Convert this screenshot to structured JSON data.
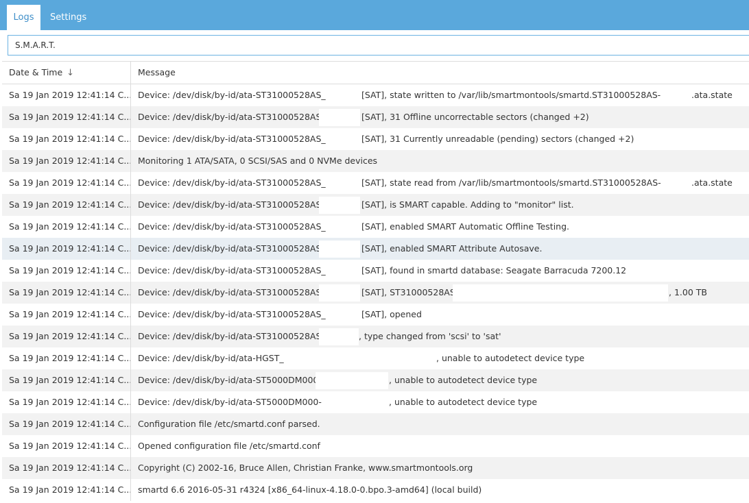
{
  "tabs": {
    "logs": "Logs",
    "settings": "Settings"
  },
  "search": {
    "value": "S.M.A.R.T."
  },
  "columns": {
    "date": "Date & Time",
    "message": "Message"
  },
  "rows": [
    {
      "date": "Sa 19 Jan 2019 12:41:14 C...",
      "msg": "Device: /dev/disk/by-id/ata-ST31000528AS_",
      "after": "[SAT], state written to /var/lib/smartmontools/smartd.ST31000528AS-",
      "tail": ".ata.state"
    },
    {
      "date": "Sa 19 Jan 2019 12:41:14 C...",
      "msg": "Device: /dev/disk/by-id/ata-ST31000528AS_",
      "after": "[SAT], 31 Offline uncorrectable sectors (changed +2)"
    },
    {
      "date": "Sa 19 Jan 2019 12:41:14 C...",
      "msg": "Device: /dev/disk/by-id/ata-ST31000528AS_",
      "after": "[SAT], 31 Currently unreadable (pending) sectors (changed +2)"
    },
    {
      "date": "Sa 19 Jan 2019 12:41:14 C...",
      "msg": "Monitoring 1 ATA/SATA, 0 SCSI/SAS and 0 NVMe devices"
    },
    {
      "date": "Sa 19 Jan 2019 12:41:14 C...",
      "msg": "Device: /dev/disk/by-id/ata-ST31000528AS_",
      "after": "[SAT], state read from /var/lib/smartmontools/smartd.ST31000528AS-",
      "tail": ".ata.state"
    },
    {
      "date": "Sa 19 Jan 2019 12:41:14 C...",
      "msg": "Device: /dev/disk/by-id/ata-ST31000528AS_",
      "after": "[SAT], is SMART capable. Adding to \"monitor\" list."
    },
    {
      "date": "Sa 19 Jan 2019 12:41:14 C...",
      "msg": "Device: /dev/disk/by-id/ata-ST31000528AS_",
      "after": "[SAT], enabled SMART Automatic Offline Testing."
    },
    {
      "date": "Sa 19 Jan 2019 12:41:14 C...",
      "msg": "Device: /dev/disk/by-id/ata-ST31000528AS_",
      "after": "[SAT], enabled SMART Attribute Autosave."
    },
    {
      "date": "Sa 19 Jan 2019 12:41:14 C...",
      "msg": "Device: /dev/disk/by-id/ata-ST31000528AS_",
      "after": "[SAT], found in smartd database: Seagate Barracuda 7200.12"
    },
    {
      "date": "Sa 19 Jan 2019 12:41:14 C...",
      "msg": "Device: /dev/disk/by-id/ata-ST31000528AS_",
      "after": "[SAT], ST31000528AS,",
      "tail": ", 1.00 TB"
    },
    {
      "date": "Sa 19 Jan 2019 12:41:14 C...",
      "msg": "Device: /dev/disk/by-id/ata-ST31000528AS_",
      "after": "[SAT], opened"
    },
    {
      "date": "Sa 19 Jan 2019 12:41:14 C...",
      "msg": "Device: /dev/disk/by-id/ata-ST31000528AS_",
      "after": ", type changed from 'scsi' to 'sat'"
    },
    {
      "date": "Sa 19 Jan 2019 12:41:14 C...",
      "msg": "Device: /dev/disk/by-id/ata-HGST_",
      "after": ", unable to autodetect device type"
    },
    {
      "date": "Sa 19 Jan 2019 12:41:14 C...",
      "msg": "Device: /dev/disk/by-id/ata-ST5000DM000-",
      "after": ", unable to autodetect device type"
    },
    {
      "date": "Sa 19 Jan 2019 12:41:14 C...",
      "msg": "Device: /dev/disk/by-id/ata-ST5000DM000-",
      "after": ", unable to autodetect device type"
    },
    {
      "date": "Sa 19 Jan 2019 12:41:14 C...",
      "msg": "Configuration file /etc/smartd.conf parsed."
    },
    {
      "date": "Sa 19 Jan 2019 12:41:14 C...",
      "msg": "Opened configuration file /etc/smartd.conf"
    },
    {
      "date": "Sa 19 Jan 2019 12:41:14 C...",
      "msg": "Copyright (C) 2002-16, Bruce Allen, Christian Franke, www.smartmontools.org"
    },
    {
      "date": "Sa 19 Jan 2019 12:41:14 C...",
      "msg": "smartd 6.6 2016-05-31 r4324 [x86_64-linux-4.18.0-0.bpo.3-amd64] (local build)"
    }
  ]
}
